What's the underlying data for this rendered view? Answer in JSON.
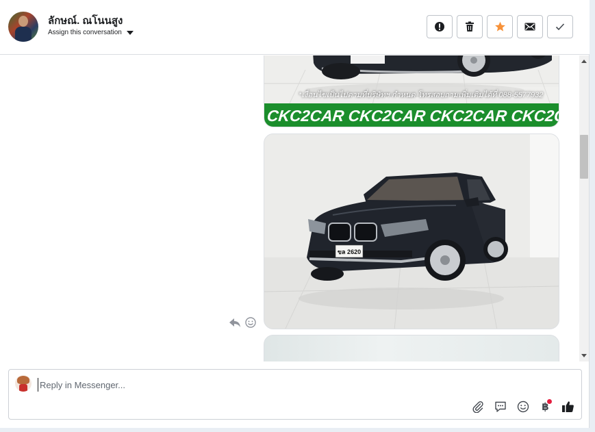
{
  "header": {
    "contact_name": "ลักษณ์. ณโนนสูง",
    "assign_label": "Assign this conversation",
    "actions": [
      {
        "name": "mark-spam-button",
        "icon": "alert-icon"
      },
      {
        "name": "delete-button",
        "icon": "trash-icon"
      },
      {
        "name": "star-button",
        "icon": "star-icon"
      },
      {
        "name": "mark-unread-button",
        "icon": "envelope-icon"
      },
      {
        "name": "mark-done-button",
        "icon": "check-icon"
      }
    ]
  },
  "messages": {
    "photo1": {
      "note": "*เงื่อนไขเป็นไปตามที่บริษัทฯ กำหนด โทรสอบถามเพิ่มเติมได้ที่ 088-5577932",
      "banner": "CKC2CAR CKC2CAR CKC2CAR CKC2CAR CKC2",
      "plate": ""
    },
    "photo2": {
      "plate": "ขล 2620"
    }
  },
  "composer": {
    "placeholder": "Reply in Messenger...",
    "value": "",
    "tools": [
      "attachment-icon",
      "saved-replies-icon",
      "emoji-icon",
      "payment-icon",
      "like-icon"
    ],
    "payment_symbol": "฿"
  },
  "colors": {
    "accent_star": "#f7923a",
    "banner_green": "#1b8e2c",
    "notification_dot": "#e41e3f"
  }
}
